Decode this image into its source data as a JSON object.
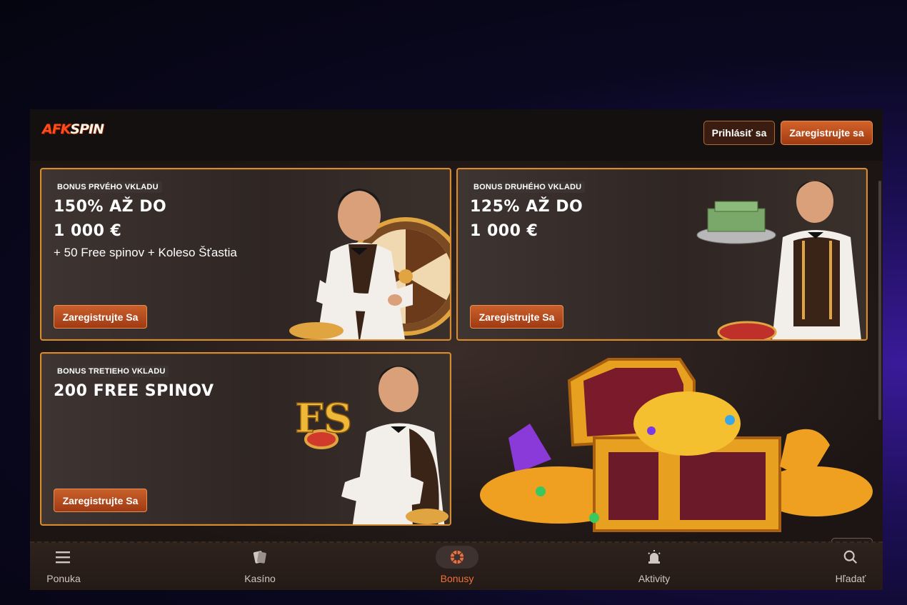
{
  "header": {
    "logo_part1": "AFK",
    "logo_part2": "SPIN",
    "login_label": "Prihlásiť sa",
    "register_label": "Zaregistrujte sa"
  },
  "bonuses": [
    {
      "tag": "BONUS PRVÉHO VKLADU",
      "line1": "150% AŽ DO",
      "line2": "1 000 €",
      "sub": "+ 50 Free spinov + Koleso Šťastia",
      "button": "Zaregistrujte Sa"
    },
    {
      "tag": "BONUS DRUHÉHO VKLADU",
      "line1": "125% AŽ DO",
      "line2": "1 000 €",
      "button": "Zaregistrujte Sa"
    },
    {
      "tag": "BONUS TRETIEHO VKLADU",
      "line1": "200 FREE SPINOV",
      "button": "Zaregistrujte Sa"
    }
  ],
  "bottom_nav": [
    {
      "label": "Ponuka",
      "icon": "menu-icon"
    },
    {
      "label": "Kasíno",
      "icon": "cards-icon"
    },
    {
      "label": "Bonusy",
      "icon": "bonus-icon",
      "active": true
    },
    {
      "label": "Aktivity",
      "icon": "siren-icon"
    },
    {
      "label": "Hľadať",
      "icon": "search-icon"
    }
  ],
  "colors": {
    "accent": "#d3632a",
    "active_nav": "#f0703a",
    "card_border": "#d58c33"
  }
}
